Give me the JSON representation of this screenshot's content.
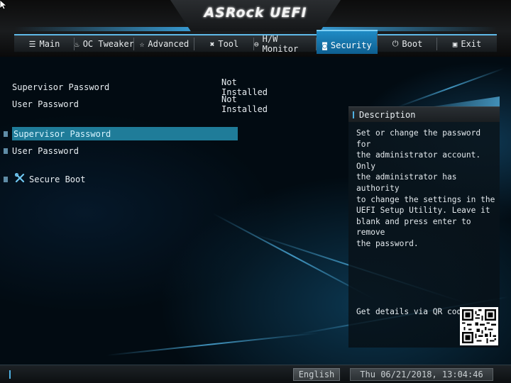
{
  "header": {
    "brand": "ASRock UEFI"
  },
  "tabs": [
    {
      "label": "Main",
      "icon": "list-icon"
    },
    {
      "label": "OC Tweaker",
      "icon": "flame-icon"
    },
    {
      "label": "Advanced",
      "icon": "star-icon"
    },
    {
      "label": "Tool",
      "icon": "tools-icon"
    },
    {
      "label": "H/W Monitor",
      "icon": "monitor-icon"
    },
    {
      "label": "Security",
      "icon": "shield-icon",
      "active": true
    },
    {
      "label": "Boot",
      "icon": "power-icon"
    },
    {
      "label": "Exit",
      "icon": "exit-icon"
    }
  ],
  "status_rows": [
    {
      "label": "Supervisor Password",
      "value": "Not Installed"
    },
    {
      "label": "User Password",
      "value": "Not Installed"
    }
  ],
  "menu_items": [
    {
      "label": "Supervisor Password",
      "selected": true
    },
    {
      "label": "User Password",
      "selected": false
    },
    {
      "label": "Secure Boot",
      "icon": "tools-icon",
      "selected": false
    }
  ],
  "description": {
    "title": "Description",
    "text_lines": [
      "Set or change the password for",
      "the administrator account. Only",
      "the administrator has authority",
      "to change the settings in the",
      "UEFI Setup Utility. Leave it",
      "blank and press enter to remove",
      "the password."
    ],
    "qr_label": "Get details via QR code"
  },
  "bottom": {
    "language": "English",
    "datetime": "Thu 06/21/2018, 13:04:46"
  },
  "colors": {
    "accent": "#1f8bc5",
    "selection": "#1f7c99",
    "tab_highlight": "#5fb9e8"
  }
}
